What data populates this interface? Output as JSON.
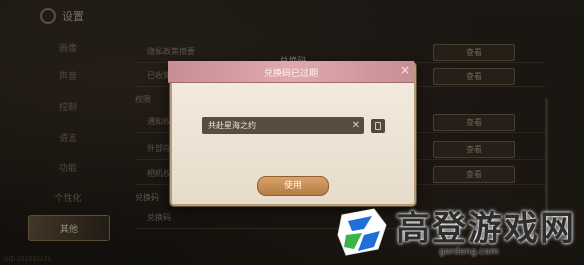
{
  "settings": {
    "title": "设置",
    "nav": [
      "画像",
      "声音",
      "控制",
      "语言",
      "功能",
      "个性化",
      "其他"
    ],
    "active_index": 6,
    "version_text": "GID 101010171"
  },
  "rows": {
    "privacy_label": "隐私政策摘要",
    "row2_label": "已收集",
    "section_permissions": "权限",
    "notify_label": "通知权",
    "external_label": "外部存",
    "camera_label": "相机权",
    "section_redeem": "兑换码",
    "redeem_label": "兑换码",
    "view_label": "查看"
  },
  "modal": {
    "title": "兑换码已过期",
    "ghost_title": "兑换码",
    "input_value": "共赴星海之约",
    "use_button": "使用"
  },
  "watermark": {
    "brand": "高登游戏网",
    "url": "gordeng.com",
    "colors": {
      "blue": "#1e6fd9",
      "green": "#39b54a"
    }
  }
}
